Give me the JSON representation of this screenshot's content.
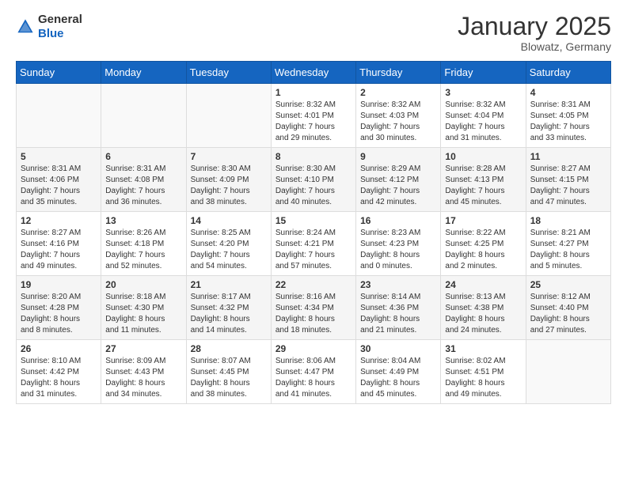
{
  "header": {
    "logo": {
      "general": "General",
      "blue": "Blue"
    },
    "title": "January 2025",
    "location": "Blowatz, Germany"
  },
  "weekdays": [
    "Sunday",
    "Monday",
    "Tuesday",
    "Wednesday",
    "Thursday",
    "Friday",
    "Saturday"
  ],
  "weeks": [
    [
      {
        "day": "",
        "info": ""
      },
      {
        "day": "",
        "info": ""
      },
      {
        "day": "",
        "info": ""
      },
      {
        "day": "1",
        "info": "Sunrise: 8:32 AM\nSunset: 4:01 PM\nDaylight: 7 hours\nand 29 minutes."
      },
      {
        "day": "2",
        "info": "Sunrise: 8:32 AM\nSunset: 4:03 PM\nDaylight: 7 hours\nand 30 minutes."
      },
      {
        "day": "3",
        "info": "Sunrise: 8:32 AM\nSunset: 4:04 PM\nDaylight: 7 hours\nand 31 minutes."
      },
      {
        "day": "4",
        "info": "Sunrise: 8:31 AM\nSunset: 4:05 PM\nDaylight: 7 hours\nand 33 minutes."
      }
    ],
    [
      {
        "day": "5",
        "info": "Sunrise: 8:31 AM\nSunset: 4:06 PM\nDaylight: 7 hours\nand 35 minutes."
      },
      {
        "day": "6",
        "info": "Sunrise: 8:31 AM\nSunset: 4:08 PM\nDaylight: 7 hours\nand 36 minutes."
      },
      {
        "day": "7",
        "info": "Sunrise: 8:30 AM\nSunset: 4:09 PM\nDaylight: 7 hours\nand 38 minutes."
      },
      {
        "day": "8",
        "info": "Sunrise: 8:30 AM\nSunset: 4:10 PM\nDaylight: 7 hours\nand 40 minutes."
      },
      {
        "day": "9",
        "info": "Sunrise: 8:29 AM\nSunset: 4:12 PM\nDaylight: 7 hours\nand 42 minutes."
      },
      {
        "day": "10",
        "info": "Sunrise: 8:28 AM\nSunset: 4:13 PM\nDaylight: 7 hours\nand 45 minutes."
      },
      {
        "day": "11",
        "info": "Sunrise: 8:27 AM\nSunset: 4:15 PM\nDaylight: 7 hours\nand 47 minutes."
      }
    ],
    [
      {
        "day": "12",
        "info": "Sunrise: 8:27 AM\nSunset: 4:16 PM\nDaylight: 7 hours\nand 49 minutes."
      },
      {
        "day": "13",
        "info": "Sunrise: 8:26 AM\nSunset: 4:18 PM\nDaylight: 7 hours\nand 52 minutes."
      },
      {
        "day": "14",
        "info": "Sunrise: 8:25 AM\nSunset: 4:20 PM\nDaylight: 7 hours\nand 54 minutes."
      },
      {
        "day": "15",
        "info": "Sunrise: 8:24 AM\nSunset: 4:21 PM\nDaylight: 7 hours\nand 57 minutes."
      },
      {
        "day": "16",
        "info": "Sunrise: 8:23 AM\nSunset: 4:23 PM\nDaylight: 8 hours\nand 0 minutes."
      },
      {
        "day": "17",
        "info": "Sunrise: 8:22 AM\nSunset: 4:25 PM\nDaylight: 8 hours\nand 2 minutes."
      },
      {
        "day": "18",
        "info": "Sunrise: 8:21 AM\nSunset: 4:27 PM\nDaylight: 8 hours\nand 5 minutes."
      }
    ],
    [
      {
        "day": "19",
        "info": "Sunrise: 8:20 AM\nSunset: 4:28 PM\nDaylight: 8 hours\nand 8 minutes."
      },
      {
        "day": "20",
        "info": "Sunrise: 8:18 AM\nSunset: 4:30 PM\nDaylight: 8 hours\nand 11 minutes."
      },
      {
        "day": "21",
        "info": "Sunrise: 8:17 AM\nSunset: 4:32 PM\nDaylight: 8 hours\nand 14 minutes."
      },
      {
        "day": "22",
        "info": "Sunrise: 8:16 AM\nSunset: 4:34 PM\nDaylight: 8 hours\nand 18 minutes."
      },
      {
        "day": "23",
        "info": "Sunrise: 8:14 AM\nSunset: 4:36 PM\nDaylight: 8 hours\nand 21 minutes."
      },
      {
        "day": "24",
        "info": "Sunrise: 8:13 AM\nSunset: 4:38 PM\nDaylight: 8 hours\nand 24 minutes."
      },
      {
        "day": "25",
        "info": "Sunrise: 8:12 AM\nSunset: 4:40 PM\nDaylight: 8 hours\nand 27 minutes."
      }
    ],
    [
      {
        "day": "26",
        "info": "Sunrise: 8:10 AM\nSunset: 4:42 PM\nDaylight: 8 hours\nand 31 minutes."
      },
      {
        "day": "27",
        "info": "Sunrise: 8:09 AM\nSunset: 4:43 PM\nDaylight: 8 hours\nand 34 minutes."
      },
      {
        "day": "28",
        "info": "Sunrise: 8:07 AM\nSunset: 4:45 PM\nDaylight: 8 hours\nand 38 minutes."
      },
      {
        "day": "29",
        "info": "Sunrise: 8:06 AM\nSunset: 4:47 PM\nDaylight: 8 hours\nand 41 minutes."
      },
      {
        "day": "30",
        "info": "Sunrise: 8:04 AM\nSunset: 4:49 PM\nDaylight: 8 hours\nand 45 minutes."
      },
      {
        "day": "31",
        "info": "Sunrise: 8:02 AM\nSunset: 4:51 PM\nDaylight: 8 hours\nand 49 minutes."
      },
      {
        "day": "",
        "info": ""
      }
    ]
  ]
}
